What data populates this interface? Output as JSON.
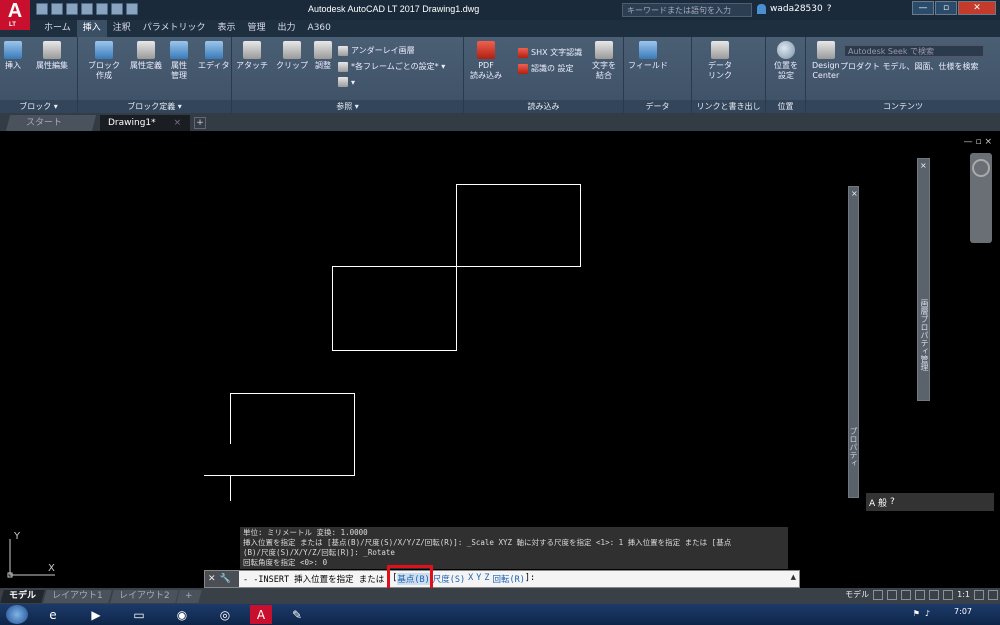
{
  "window": {
    "title": "Autodesk AutoCAD LT 2017    Drawing1.dwg",
    "search_placeholder": "キーワードまたは語句を入力",
    "user_name": "wada28530",
    "app_badge": "LT"
  },
  "ribbon_tabs": [
    "ホーム",
    "挿入",
    "注釈",
    "パラメトリック",
    "表示",
    "管理",
    "出力",
    "A360"
  ],
  "ribbon": {
    "groups": {
      "block": "ブロック ▾",
      "block_def": "ブロック定義 ▾",
      "reference": "参照 ▾",
      "import": "読み込み",
      "data": "データ",
      "link_extract": "リンクと書き出し",
      "location": "位置",
      "content": "コンテンツ"
    },
    "buttons": {
      "insert": "挿入",
      "attr_edit": "属性編集",
      "block_create": "ブロック\n作成",
      "attr_define": "属性定義",
      "attr_manage": "属性\n管理",
      "editor": "エディタ",
      "attach": "アタッチ",
      "clip": "クリップ",
      "adjust": "調整",
      "underlay": "アンダーレイ画層",
      "frame": "*各フレームごとの設定* ▾",
      "pdf_import": "PDF\n読み込み",
      "shx_recog": "SHX 文字認識",
      "recog_settings": "認識の 設定",
      "combine_text": "文字を\n結合",
      "field": "フィールド",
      "data_link": "データ\nリンク",
      "set_location": "位置を\n設定",
      "design_center": "Design\nCenter",
      "seek_search": "Autodesk Seek で検索",
      "seek_desc": "プロダクト モデル、図面、仕様を検索"
    }
  },
  "file_tabs": {
    "start": "スタート",
    "drawing": "Drawing1*",
    "close": "×",
    "add": "+"
  },
  "viewport_controls": "— ▫ ×",
  "palettes": {
    "props": "プロパティ",
    "layer_props": "画層プロパティ管理"
  },
  "command_history": [
    "単位: ミリメートル   変換:    1.0000",
    "挿入位置を指定 または [基点(B)/尺度(S)/X/Y/Z/回転(R)]: _Scale XYZ 軸に対する尺度を指定 <1>: 1 挿入位置を指定 または [基点",
    "(B)/尺度(S)/X/Y/Z/回転(R)]: _Rotate",
    "回転角度を指定 <0>: 0"
  ],
  "command_line": {
    "prefix": "- -INSERT 挿入位置を指定 または",
    "bracket_open": "[",
    "opt_base": "基点(B)",
    "opt_scale": "尺度(S)",
    "opt_x": "X",
    "opt_y": "Y",
    "opt_z": "Z",
    "opt_rotate": "回転(R)",
    "suffix": "]:"
  },
  "ucs": {
    "x_label": "X",
    "y_label": "Y"
  },
  "layout_tabs": [
    "モデル",
    "レイアウト1",
    "レイアウト2",
    "+"
  ],
  "status": {
    "model": "モデル",
    "scale": "1:1",
    "tray_text": "A 般"
  },
  "clock": "7:07",
  "colors": {
    "accent_red": "#e0101a",
    "autocad_red": "#c8102e",
    "option_blue": "#1a5fb4"
  }
}
